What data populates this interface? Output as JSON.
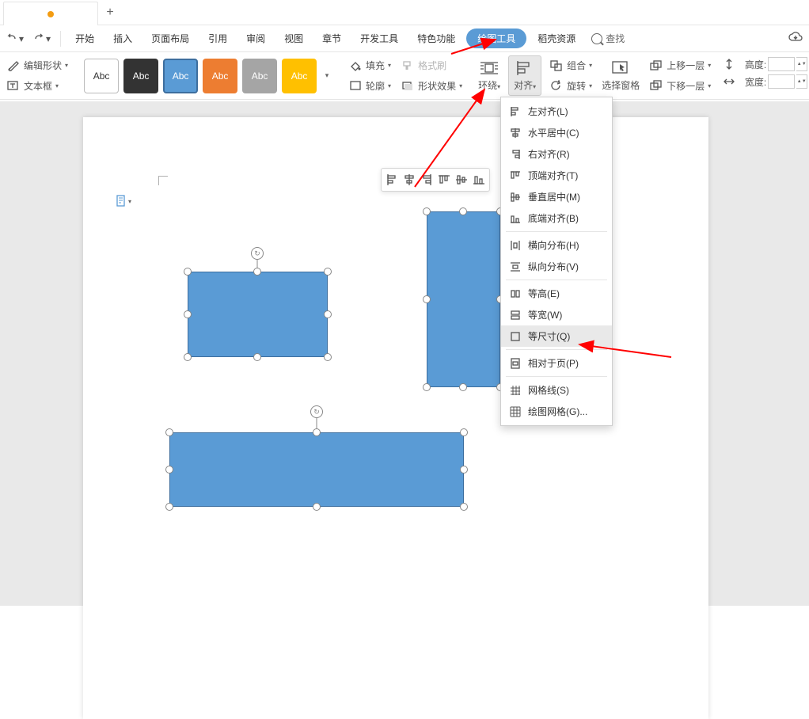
{
  "titlebar": {
    "add_tab": "+"
  },
  "menubar": {
    "items": [
      "开始",
      "插入",
      "页面布局",
      "引用",
      "审阅",
      "视图",
      "章节",
      "开发工具",
      "特色功能",
      "绘图工具",
      "稻壳资源"
    ],
    "active_index": 9,
    "search_label": "查找"
  },
  "ribbon": {
    "left": {
      "edit_shape": "编辑形状",
      "textbox": "文本框"
    },
    "swatch_label": "Abc",
    "fill": {
      "label": "填充",
      "dd": "▾"
    },
    "outline": {
      "label": "轮廓",
      "dd": "▾"
    },
    "format_brush": "格式刷",
    "shape_effect": {
      "label": "形状效果",
      "dd": "▾"
    },
    "wrap": {
      "label": "环绕",
      "dd": "▾"
    },
    "align": {
      "label": "对齐",
      "dd": "▾"
    },
    "group": {
      "label": "组合",
      "dd": "▾"
    },
    "rotate": {
      "label": "旋转",
      "dd": "▾"
    },
    "select_pane": "选择窗格",
    "bring_fwd": {
      "label": "上移一层",
      "dd": "▾"
    },
    "send_back": {
      "label": "下移一层",
      "dd": "▾"
    },
    "size": {
      "height_label": "高度:",
      "width_label": "宽度:"
    }
  },
  "dropdown": {
    "items": [
      {
        "label": "左对齐(L)"
      },
      {
        "label": "水平居中(C)"
      },
      {
        "label": "右对齐(R)"
      },
      {
        "label": "顶端对齐(T)"
      },
      {
        "label": "垂直居中(M)"
      },
      {
        "label": "底端对齐(B)"
      }
    ],
    "group2": [
      {
        "label": "横向分布(H)"
      },
      {
        "label": "纵向分布(V)"
      }
    ],
    "group3": [
      {
        "label": "等高(E)"
      },
      {
        "label": "等宽(W)"
      },
      {
        "label": "等尺寸(Q)"
      }
    ],
    "highlight_label": "等尺寸(Q)",
    "group4": [
      {
        "label": "相对于页(P)"
      }
    ],
    "group5": [
      {
        "label": "网格线(S)"
      },
      {
        "label": "绘图网格(G)..."
      }
    ]
  }
}
